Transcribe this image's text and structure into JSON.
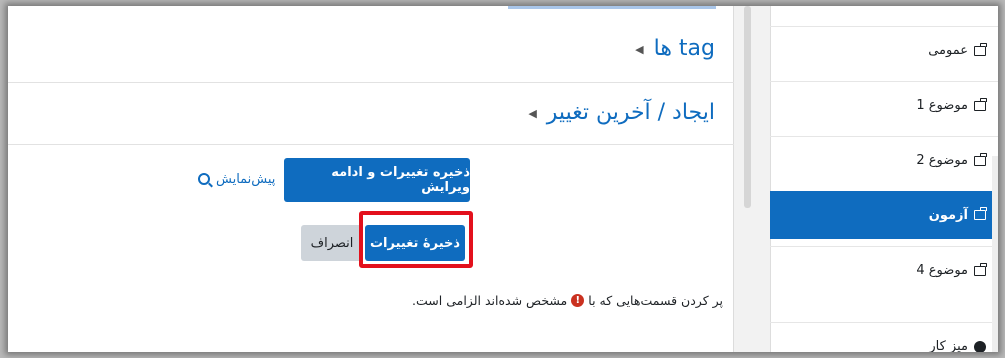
{
  "main": {
    "sections": [
      {
        "label": "tag ها"
      },
      {
        "label": "ایجاد / آخرین تغییر"
      }
    ],
    "buttons": {
      "save_continue": "ذخیره تغییرات و ادامه ویرایش",
      "preview": "پیش‌نمایش",
      "save": "ذخیرهٔ تغییرات",
      "cancel": "انصراف"
    },
    "required_note": {
      "before": "پر کردن قسمت‌هایی که با",
      "after": "مشخص شده‌اند الزامی است.",
      "icon": "!"
    }
  },
  "nav": {
    "items": [
      {
        "label": "عمومی",
        "icon": "folder-icon"
      },
      {
        "label": "موضوع 1",
        "icon": "folder-icon"
      },
      {
        "label": "موضوع 2",
        "icon": "folder-icon"
      },
      {
        "label": "آزمون",
        "icon": "folder-icon",
        "active": true
      },
      {
        "label": "موضوع 4",
        "icon": "folder-icon"
      },
      {
        "label": "میز کار",
        "icon": "dashboard-icon"
      }
    ]
  },
  "colors": {
    "primary": "#0f6cbf",
    "highlight": "#e3101c",
    "required": "#ca3120"
  }
}
